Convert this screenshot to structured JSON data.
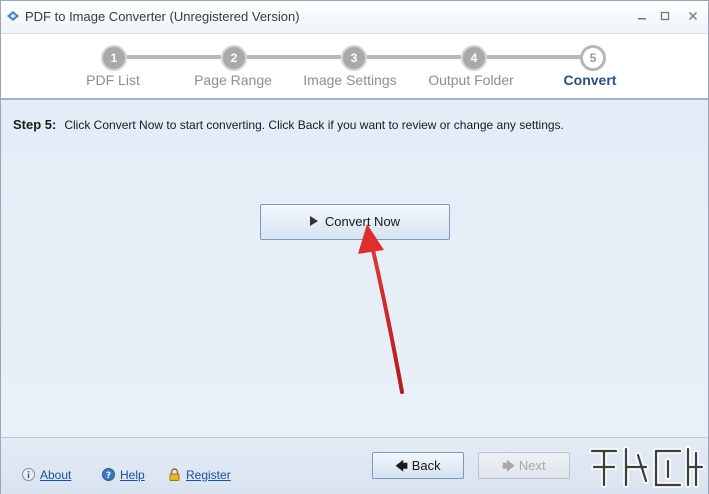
{
  "window": {
    "title": "PDF to Image Converter (Unregistered Version)",
    "minimize": "—",
    "maximize": "□",
    "close": "✕"
  },
  "steps": [
    {
      "number": "1",
      "label": "PDF List",
      "state": "done"
    },
    {
      "number": "2",
      "label": "Page Range",
      "state": "done"
    },
    {
      "number": "3",
      "label": "Image Settings",
      "state": "done"
    },
    {
      "number": "4",
      "label": "Output Folder",
      "state": "done"
    },
    {
      "number": "5",
      "label": "Convert",
      "state": "active"
    }
  ],
  "content": {
    "step_number": "Step 5:",
    "step_description": "Click Convert Now to start converting. Click Back if you want to review or change any settings.",
    "convert_button_label": "Convert Now"
  },
  "footer": {
    "links": [
      {
        "label": "About",
        "icon": "info-icon"
      },
      {
        "label": "Help",
        "icon": "help-icon"
      },
      {
        "label": "Register",
        "icon": "lock-icon"
      }
    ],
    "back_label": "Back",
    "next_label": "Next"
  },
  "colors": {
    "accent_active_step": "#2c4f7c",
    "link": "#1d4fa3",
    "annotation_arrow": "#d42a2a"
  }
}
